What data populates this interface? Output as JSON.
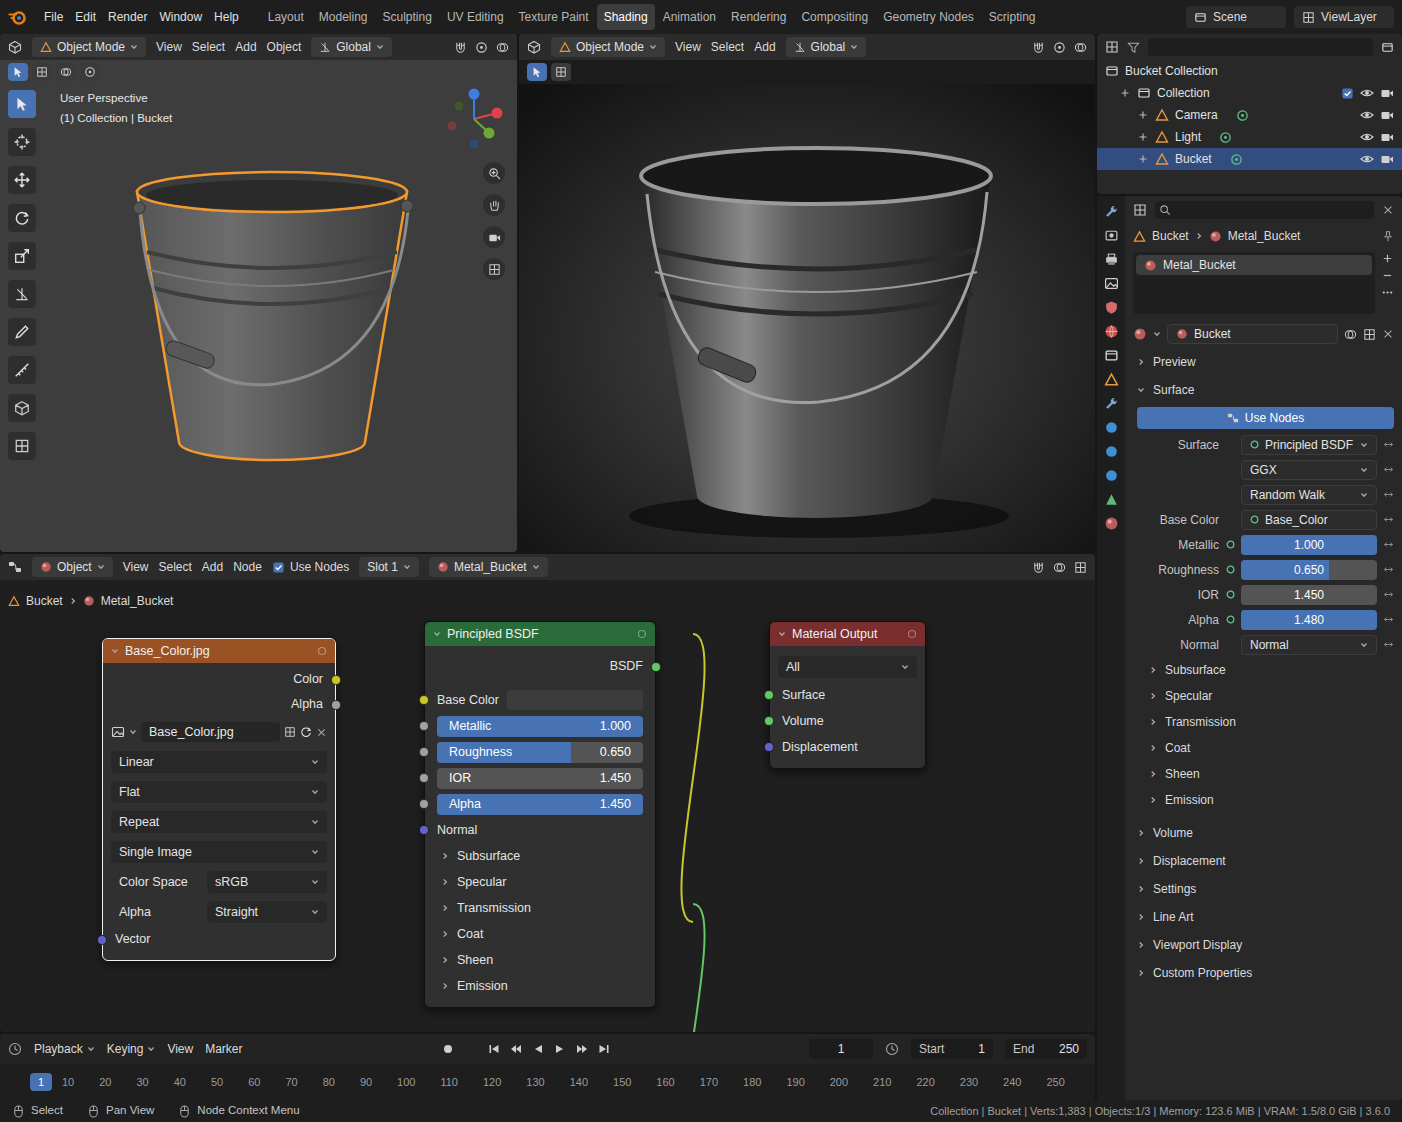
{
  "top_bar": {
    "menu": [
      "File",
      "Edit",
      "Render",
      "Window",
      "Help"
    ],
    "workspaces": [
      {
        "label": "Layout",
        "selected": false
      },
      {
        "label": "Modeling",
        "selected": false
      },
      {
        "label": "Sculpting",
        "selected": false
      },
      {
        "label": "UV Editing",
        "selected": false
      },
      {
        "label": "Texture Paint",
        "selected": false
      },
      {
        "label": "Shading",
        "selected": true
      },
      {
        "label": "Animation",
        "selected": false
      },
      {
        "label": "Rendering",
        "selected": false
      },
      {
        "label": "Compositing",
        "selected": false
      },
      {
        "label": "Geometry Nodes",
        "selected": false
      },
      {
        "label": "Scripting",
        "selected": false
      }
    ],
    "scene": "Scene",
    "view_layer": "ViewLayer"
  },
  "viewport": {
    "mode": "Object Mode",
    "menus": [
      "View",
      "Select",
      "Add",
      "Object"
    ],
    "orientation": "Global",
    "perspective": "User Perspective",
    "context": "(1) Collection | Bucket"
  },
  "render_view": {
    "mode": "Object Mode",
    "menus": [
      "View",
      "Select",
      "Add"
    ],
    "orientation": "Global"
  },
  "outliner": {
    "root": "Bucket Collection",
    "items": [
      {
        "label": "Collection",
        "kind": "collection",
        "selected": false
      },
      {
        "label": "Camera",
        "kind": "object",
        "selected": false
      },
      {
        "label": "Light",
        "kind": "object",
        "selected": false
      },
      {
        "label": "Bucket",
        "kind": "object",
        "selected": true
      }
    ]
  },
  "properties": {
    "breadcrumb": [
      "Bucket",
      "Metal_Bucket"
    ],
    "slots": [
      {
        "label": "Metal_Bucket",
        "selected": true
      }
    ],
    "material": "Bucket",
    "panels_before": [
      {
        "label": "Preview",
        "expanded": false
      },
      {
        "label": "Surface",
        "expanded": true
      }
    ],
    "use_nodes": {
      "label": "Use Nodes",
      "on": true
    },
    "fields": [
      {
        "label": "Surface",
        "kind": "shader",
        "value": "Principled BSDF"
      },
      {
        "kind": "dropdown",
        "value": "GGX"
      },
      {
        "kind": "dropdown",
        "value": "Random Walk"
      },
      {
        "label": "Base Color",
        "kind": "link",
        "value": "Base_Color"
      },
      {
        "label": "Metallic",
        "kind": "slider",
        "value": "1.000",
        "level": 1
      },
      {
        "label": "Roughness",
        "kind": "slider",
        "value": "0.650",
        "level": 0.65
      },
      {
        "label": "IOR",
        "kind": "slider",
        "value": "1.450",
        "level": 0
      },
      {
        "label": "Alpha",
        "kind": "slider",
        "value": "1.480",
        "level": 1
      },
      {
        "label": "Normal",
        "kind": "dropdown",
        "value": "Normal"
      }
    ],
    "subpanels": [
      "Subsurface",
      "Specular",
      "Transmission",
      "Coat",
      "Sheen",
      "Emission"
    ],
    "panels_after": [
      {
        "label": "Volume",
        "expanded": false
      },
      {
        "label": "Displacement",
        "expanded": false
      },
      {
        "label": "Settings",
        "expanded": false
      },
      {
        "label": "Line Art",
        "expanded": false
      },
      {
        "label": "Viewport Display",
        "expanded": false
      },
      {
        "label": "Custom Properties",
        "expanded": false
      }
    ]
  },
  "node_editor": {
    "header": {
      "object": "Object",
      "menus": [
        "View",
        "Select",
        "Add",
        "Node"
      ],
      "use_nodes": {
        "label": "Use Nodes",
        "checked": true
      },
      "slot": "Slot 1",
      "material": "Metal_Bucket"
    },
    "breadcrumb": [
      "Bucket",
      "Metal_Bucket"
    ],
    "image_node": {
      "title": "Base_Color.jpg",
      "selected": true,
      "outputs": [
        {
          "label": "Color",
          "kind": "color"
        },
        {
          "label": "Alpha",
          "kind": "float"
        }
      ],
      "image": "Base_Color.jpg",
      "options": [
        "Linear",
        "Flat",
        "Repeat",
        "Single Image"
      ],
      "settings": [
        {
          "label": "Color Space",
          "value": "sRGB"
        },
        {
          "label": "Alpha",
          "value": "Straight"
        }
      ],
      "inputs": [
        {
          "label": "Vector",
          "kind": "vector"
        }
      ]
    },
    "bsdf_node": {
      "title": "Principled BSDF",
      "selected": false,
      "output": {
        "label": "BSDF",
        "kind": "shader"
      },
      "inputs": [
        {
          "label": "Base Color",
          "kind": "color"
        },
        {
          "label": "Metallic",
          "kind": "slider",
          "value": "1.000",
          "level": 1
        },
        {
          "label": "Roughness",
          "kind": "slider",
          "value": "0.650",
          "level": 0.65
        },
        {
          "label": "IOR",
          "kind": "slider",
          "value": "1.450",
          "level": 0
        },
        {
          "label": "Alpha",
          "kind": "slider",
          "value": "1.450",
          "level": 1
        },
        {
          "label": "Normal",
          "kind": "vector"
        }
      ],
      "panels": [
        "Subsurface",
        "Specular",
        "Transmission",
        "Coat",
        "Sheen",
        "Emission"
      ]
    },
    "output_node": {
      "title": "Material Output",
      "selected": false,
      "target": "All",
      "inputs": [
        {
          "label": "Surface",
          "kind": "shader"
        },
        {
          "label": "Volume",
          "kind": "shader"
        },
        {
          "label": "Displacement",
          "kind": "vector"
        }
      ]
    }
  },
  "timeline": {
    "menus": [
      {
        "label": "Playback",
        "kind": "dropdown"
      },
      {
        "label": "Keying",
        "kind": "dropdown"
      },
      {
        "label": "View",
        "kind": "menu"
      },
      {
        "label": "Marker",
        "kind": "menu"
      }
    ],
    "frame": "1",
    "start": {
      "label": "Start",
      "value": "1"
    },
    "end": {
      "label": "End",
      "value": "250"
    },
    "playhead": "1",
    "ticks": [
      "10",
      "20",
      "30",
      "40",
      "50",
      "60",
      "70",
      "80",
      "90",
      "100",
      "110",
      "120",
      "130",
      "140",
      "150",
      "160",
      "170",
      "180",
      "190",
      "200",
      "210",
      "220",
      "230",
      "240",
      "250"
    ]
  },
  "status_bar": {
    "hints": [
      "Select",
      "Pan View",
      "Node Context Menu"
    ],
    "info": "Collection | Bucket | Verts:1,383 | Objects:1/3 | Memory: 123.6 MiB | VRAM: 1.5/8.0 GiB | 3.6.0"
  }
}
